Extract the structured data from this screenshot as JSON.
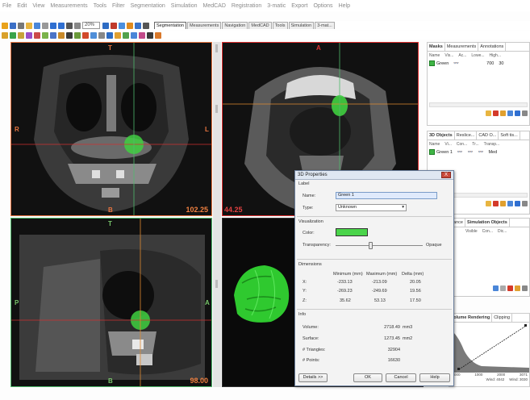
{
  "menu": [
    "File",
    "Edit",
    "View",
    "Measurements",
    "Tools",
    "Filter",
    "Segmentation",
    "Simulation",
    "MedCAD",
    "Registration",
    "3-matic",
    "Export",
    "Options",
    "Help"
  ],
  "toolbar": {
    "zoom_value": "20%",
    "tabs": [
      "Segmentation",
      "Measurements",
      "Navigation",
      "MedCAD",
      "Tools",
      "Simulation",
      "3-mat..."
    ],
    "active_tab": "Segmentation"
  },
  "viewports": {
    "coronal": {
      "top": "T",
      "left": "R",
      "right": "L",
      "bottom": "B",
      "slice": "102.25"
    },
    "axial": {
      "top": "A",
      "slice": "44.25"
    },
    "sagittal": {
      "top": "T",
      "left": "P",
      "right": "A",
      "bottom": "B",
      "slice": "98.00"
    }
  },
  "masks_panel": {
    "tabs": [
      "Masks",
      "Measurements",
      "Annotations"
    ],
    "columns": [
      "Name",
      "Vis...",
      "Ac...",
      "Lowe...",
      "High..."
    ],
    "row": {
      "name": "Green",
      "lower": "700",
      "high": "30"
    }
  },
  "objects_panel": {
    "tabs": [
      "3D Objects",
      "Reslice...",
      "CAD O...",
      "Soft tis..."
    ],
    "columns": [
      "Name",
      "Vi...",
      "Con...",
      "Tr...",
      "Transp..."
    ],
    "row": {
      "name": "Green 1",
      "last": "Med"
    }
  },
  "sim_panel": {
    "tabs": [
      "dance",
      "Simulation Objects"
    ],
    "columns": [
      "Visible",
      "Con...",
      "Dic..."
    ]
  },
  "render_panel": {
    "tabs": [
      "Volume Rendering",
      "Clipping"
    ],
    "axis": [
      "-1000",
      "1000",
      "2000",
      "3071"
    ],
    "footer": [
      "Wind: 4042",
      "Wind: 3030"
    ]
  },
  "dialog": {
    "title": "3D Properties",
    "close": "X",
    "label_section": "Label",
    "name_label": "Name:",
    "name_value": "Green 1",
    "type_label": "Type:",
    "type_value": "Unknown",
    "visualization_section": "Visualization",
    "color_label": "Color:",
    "color": "#4ad44a",
    "transparency_label": "Transparency:",
    "transparency_right": "Opaque",
    "transparency_level": 0.4,
    "dimensions_section": "Dimensions",
    "dim_headers": [
      "Minimum (mm)",
      "Maximum (mm)",
      "Delta (mm)"
    ],
    "dims": [
      {
        "axis": "X:",
        "min": "-233.13",
        "max": "-213.09",
        "delta": "20.05"
      },
      {
        "axis": "Y:",
        "min": "-269.23",
        "max": "-249.69",
        "delta": "19.56"
      },
      {
        "axis": "Z:",
        "min": "35.62",
        "max": "53.13",
        "delta": "17.50"
      }
    ],
    "info_section": "Info",
    "info": [
      {
        "label": "Volume:",
        "value": "2718.49",
        "unit": "mm3"
      },
      {
        "label": "Surface:",
        "value": "1273.45",
        "unit": "mm2"
      },
      {
        "label": "# Triangles:",
        "value": "32904",
        "unit": ""
      },
      {
        "label": "# Points:",
        "value": "16630",
        "unit": ""
      }
    ],
    "details_btn": "Details >>",
    "ok_btn": "OK",
    "cancel_btn": "Cancel",
    "help_btn": "Help"
  },
  "colors": {
    "segment_green": "#4ad44a",
    "coronal_border": "#e8743f",
    "axial_border": "#e03030",
    "sagittal_border": "#4fb96b"
  }
}
